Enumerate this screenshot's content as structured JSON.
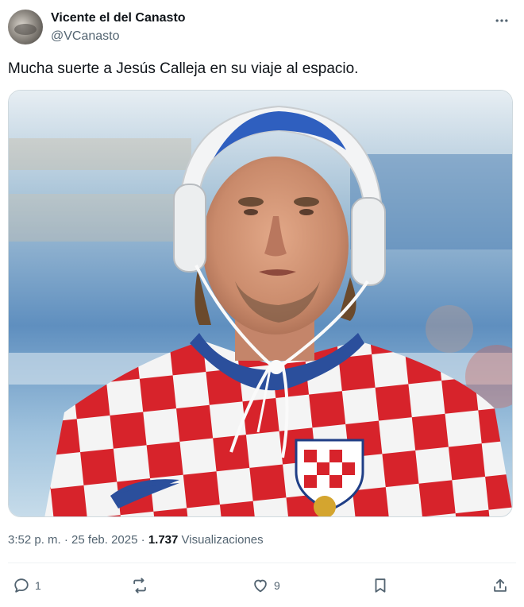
{
  "author": {
    "display_name": "Vicente el del Canasto",
    "handle": "@VCanasto"
  },
  "more_icon": "more-horizontal-icon",
  "tweet": {
    "text": "Mucha suerte a Jesús Calleja en su viaje al espacio."
  },
  "meta": {
    "time": "3:52 p. m.",
    "separator1": " · ",
    "date": "25 feb. 2025",
    "separator2": " · ",
    "views_count": "1.737",
    "views_label": " Visualizaciones"
  },
  "actions": {
    "replies": "1",
    "likes": "9"
  },
  "colors": {
    "text_primary": "#0f1419",
    "text_secondary": "#536471",
    "jersey_red": "#d7232b",
    "cap_blue": "#2f5fbf"
  }
}
